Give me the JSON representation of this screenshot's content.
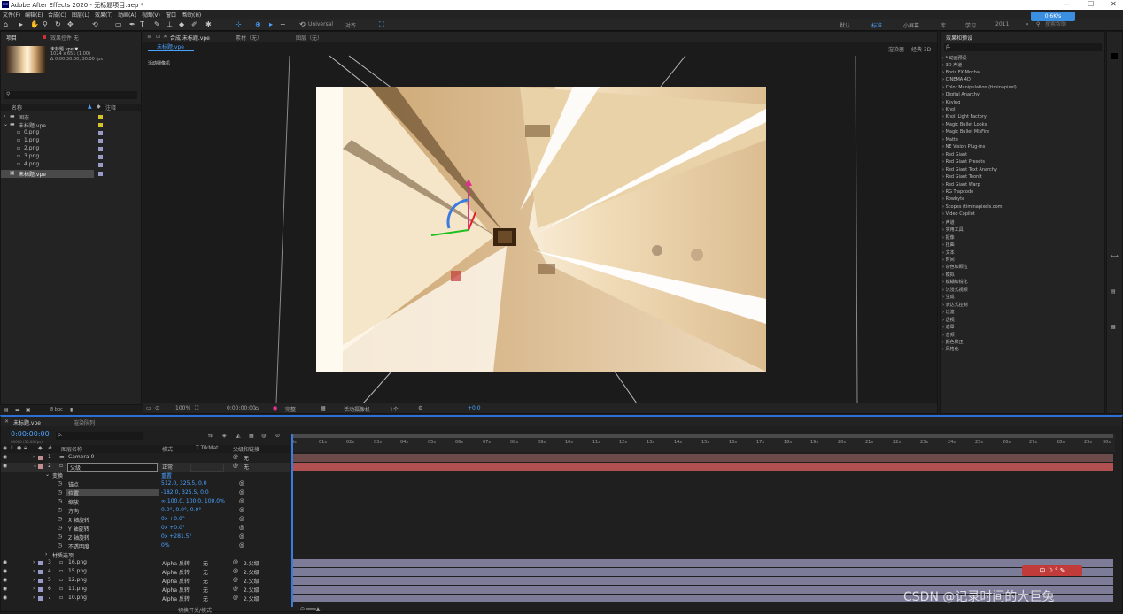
{
  "app": {
    "title": "Adobe After Effects 2020 - 无标题项目.aep *",
    "brand_color": "#9999ff"
  },
  "menu": [
    "文件(F)",
    "编辑(E)",
    "合成(C)",
    "图层(L)",
    "效果(T)",
    "动画(A)",
    "视图(V)",
    "窗口",
    "帮助(H)"
  ],
  "toolbar": {
    "universal_label": "Universal",
    "align_label": "对齐"
  },
  "workspaces": [
    "默认",
    "标准",
    "小屏幕",
    "库",
    "学习",
    "2011"
  ],
  "search_help": {
    "placeholder": "搜索帮助"
  },
  "network_badge": "0.6K/s",
  "project": {
    "tab": "项目",
    "effects_tab": "效果控件 无",
    "comp_name": "未标题.vpe ▼",
    "comp_info1": "1024 x 651 (1.00)",
    "comp_info2": "Δ 0:00:30:00, 30.00 fps",
    "col_name": "名称",
    "col_label": "注释",
    "items": [
      {
        "name": "固态",
        "indent": 0,
        "color": "#d6c22b"
      },
      {
        "name": "未标题.vpe",
        "indent": 0,
        "color": "#d6c22b"
      },
      {
        "name": "0.png",
        "indent": 1,
        "color": "#9a9ac8"
      },
      {
        "name": "1.png",
        "indent": 1,
        "color": "#9a9ac8"
      },
      {
        "name": "2.png",
        "indent": 1,
        "color": "#9a9ac8"
      },
      {
        "name": "3.png",
        "indent": 1,
        "color": "#9a9ac8"
      },
      {
        "name": "4.png",
        "indent": 1,
        "color": "#9a9ac8"
      },
      {
        "name": "未标题.vpe",
        "indent": 0,
        "color": "#9a9ac8",
        "selected": true
      }
    ],
    "bpc": "8 bpc"
  },
  "composition": {
    "tab": "合成 未标题.vpe",
    "layer_tab": "素材（无）",
    "layer_tab2": "图层（无）",
    "subtab": "未标题.vpe",
    "camera_label": "活动摄像机",
    "renderer": "渲染器",
    "renderer_value": "经典 3D",
    "zoom": "100%",
    "timecode": "0:00:00:00",
    "quality": "完整",
    "view": "活动摄像机",
    "views": "1个...",
    "exposure": "+0.0"
  },
  "effects": {
    "title": "效果和预设",
    "search_placeholder": "ρ.",
    "items": [
      "* 动画预设",
      "3D 声道",
      "Boris FX Mocha",
      "CINEMA 4D",
      "Color Manipulation (timinapixel)",
      "Digital Anarchy",
      "Keying",
      "Knoll",
      "Knoll Light Factory",
      "Magic Bullet Looks",
      "Magic Bullet MisFire",
      "Matte",
      "NE Vision Plug-ins",
      "Red Giant",
      "Red Giant Presets",
      "Red Giant Text Anarchy",
      "Red Giant ToonIt",
      "Red Giant Warp",
      "RG Trapcode",
      "Rowbyte",
      "Scopes (timinapixels.com)",
      "Video Copilot",
      "声道",
      "实用工具",
      "抠像",
      "扭曲",
      "文本",
      "时间",
      "杂色和颗粒",
      "模拟",
      "模糊和锐化",
      "沉浸式视频",
      "生成",
      "表达式控制",
      "过渡",
      "透视",
      "遮罩",
      "音频",
      "颜色校正",
      "风格化"
    ]
  },
  "timeline": {
    "tab": "未标题.vpe",
    "render_tab": "渲染队列",
    "timecode": "0:00:00:00",
    "fps": "00000 (30.00 fps)",
    "search_placeholder": "ρ.",
    "col_name": "图层名称",
    "col_mode": "模式",
    "col_trkmat": "T TrkMat",
    "col_parent": "父级和链接",
    "ruler": [
      "0s",
      "01s",
      "02s",
      "03s",
      "04s",
      "05s",
      "06s",
      "07s",
      "08s",
      "09s",
      "10s",
      "11s",
      "12s",
      "13s",
      "14s",
      "15s",
      "16s",
      "17s",
      "18s",
      "19s",
      "20s",
      "21s",
      "22s",
      "23s",
      "24s",
      "25s",
      "26s",
      "27s",
      "28s",
      "29s",
      "30s"
    ],
    "layers_top": [
      {
        "num": "1",
        "name": "Camera 0",
        "mode": "",
        "trk": "",
        "parent": "无",
        "color": "#c28f8f",
        "bar": "#7a4e4e"
      },
      {
        "num": "2",
        "name": "父级",
        "mode": "正常",
        "trk": "",
        "parent": "无",
        "color": "#c28f8f",
        "bar": "#b15353"
      }
    ],
    "transform_label": "变换",
    "reset_label": "重置",
    "props": [
      {
        "name": "锚点",
        "value": "512.0, 325.5, 0.0"
      },
      {
        "name": "位置",
        "value": "-182.0, 325.5, 0.0"
      },
      {
        "name": "缩放",
        "value": "∞ 100.0, 100.0, 100.0%"
      },
      {
        "name": "方向",
        "value": "0.0°, 0.0°, 0.0°"
      },
      {
        "name": "X 轴旋转",
        "value": "0x +0.0°"
      },
      {
        "name": "Y 轴旋转",
        "value": "0x +0.0°"
      },
      {
        "name": "Z 轴旋转",
        "value": "0x +281.5°"
      },
      {
        "name": "不透明度",
        "value": "0%"
      }
    ],
    "material_label": "材质选项",
    "layers_bottom": [
      {
        "num": "3",
        "name": "16.png",
        "mode": "Alpha 反转",
        "trk": "无",
        "parent": "2.父级"
      },
      {
        "num": "4",
        "name": "15.png",
        "mode": "Alpha 反转",
        "trk": "无",
        "parent": "2.父级"
      },
      {
        "num": "5",
        "name": "12.png",
        "mode": "Alpha 反转",
        "trk": "无",
        "parent": "2.父级"
      },
      {
        "num": "6",
        "name": "11.png",
        "mode": "Alpha 反转",
        "trk": "无",
        "parent": "2.父级"
      },
      {
        "num": "7",
        "name": "10.png",
        "mode": "Alpha 反转",
        "trk": "无",
        "parent": "2.父级"
      }
    ],
    "footer": "切换开关/模式"
  },
  "watermark": "CSDN @记录时间的大巨兔",
  "ime_bar": "中 ☽ ° ✎"
}
